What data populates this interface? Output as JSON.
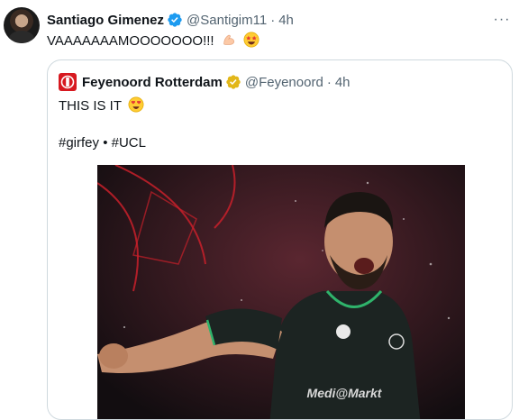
{
  "tweet": {
    "author_name": "Santiago Gimenez",
    "author_handle": "@Santigim11",
    "time": "4h",
    "separator": "·",
    "more_label": "···",
    "text": "VAAAAAAAMOOOOOOO!!!",
    "emojis": [
      "flexed-biceps-emoji",
      "star-struck-emoji"
    ]
  },
  "quoted": {
    "author_name": "Feyenoord Rotterdam",
    "author_handle": "@Feyenoord",
    "time": "4h",
    "separator": "·",
    "text_line1": "THIS IS IT",
    "text_line2": "#girfey • #UCL",
    "emoji": "heart-eyes-emoji",
    "image_description_icon": "celebrating-player-photo"
  },
  "colors": {
    "verified_blue": "#1d9bf0",
    "verified_gold": "#e2b719",
    "feyenoord_red": "#d71920",
    "secondary_text": "#536471",
    "border": "#cfd9de"
  }
}
